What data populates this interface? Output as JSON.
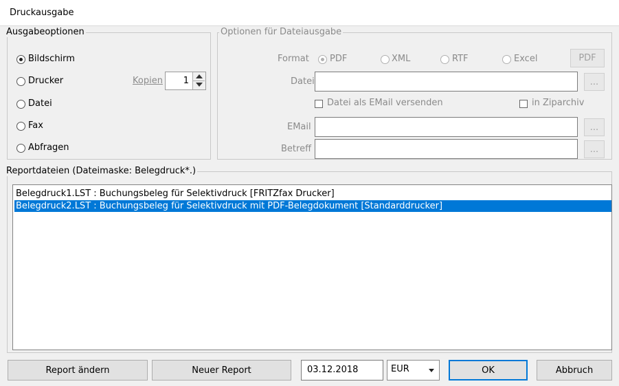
{
  "window": {
    "title": "Druckausgabe"
  },
  "ausgabeoptionen": {
    "legend": "Ausgabeoptionen",
    "options": [
      "Bildschirm",
      "Drucker",
      "Datei",
      "Fax",
      "Abfragen"
    ],
    "selected": "Bildschirm",
    "kopien_label": "Kopien",
    "kopien_value": "1"
  },
  "dateiausgabe": {
    "legend": "Optionen für Dateiausgabe",
    "format_label": "Format",
    "formats": [
      "PDF",
      "XML",
      "RTF",
      "Excel"
    ],
    "selected_format": "PDF",
    "format_button": "PDF",
    "datei_label": "Datei",
    "datei_value": "",
    "browse_label": "...",
    "email_check_label": "Datei als EMail versenden",
    "zip_check_label": "in Ziparchiv",
    "email_label": "EMail",
    "email_value": "",
    "betreff_label": "Betreff",
    "betreff_value": ""
  },
  "reportdateien": {
    "legend": "Reportdateien  (Dateimaske: Belegdruck*.)",
    "items": [
      {
        "text": "Belegdruck1.LST : Buchungsbeleg für Selektivdruck [FRITZfax Drucker]",
        "selected": false
      },
      {
        "text": "Belegdruck2.LST : Buchungsbeleg für Selektivdruck mit PDF-Belegdokument [Standarddrucker]",
        "selected": true
      }
    ]
  },
  "footer": {
    "report_aendern": "Report ändern",
    "neuer_report": "Neuer Report",
    "date": "03.12.2018",
    "currency": "EUR",
    "ok": "OK",
    "abbruch": "Abbruch"
  },
  "colors": {
    "selection": "#0078d7",
    "default_button_border": "#0078d7",
    "background": "#f0f0f0"
  }
}
